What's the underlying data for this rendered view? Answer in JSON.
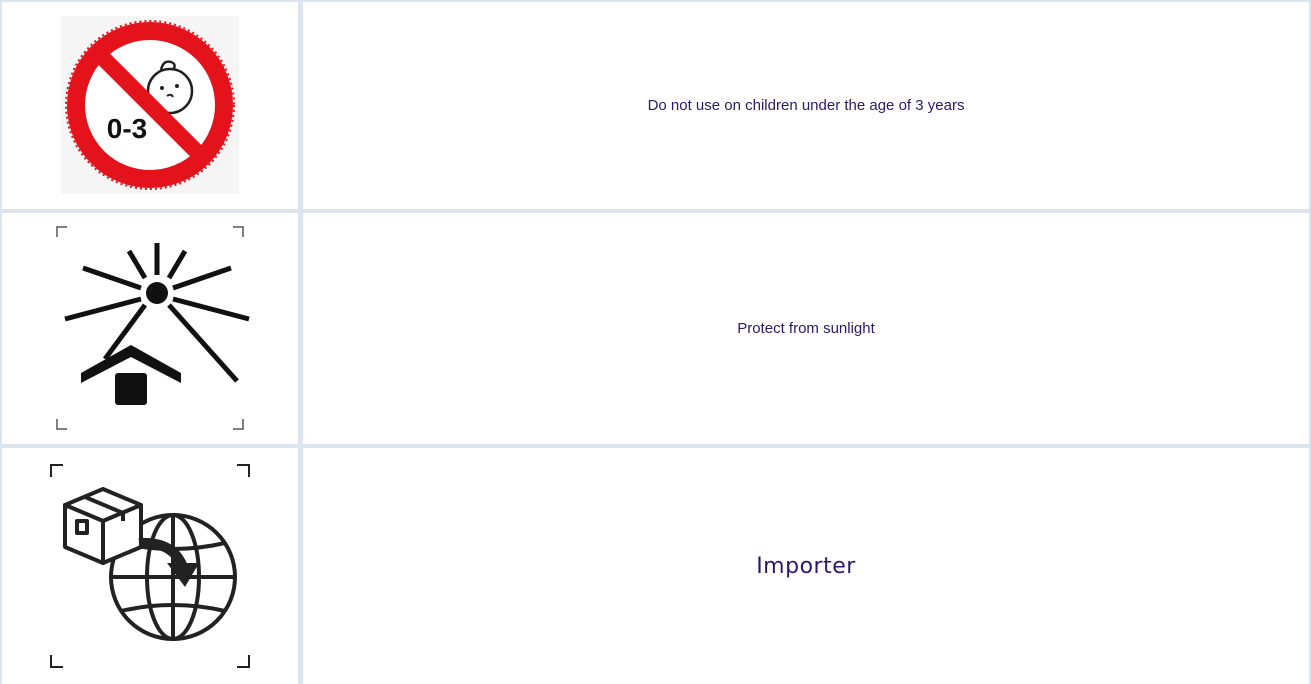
{
  "rows": [
    {
      "icon": "no-children-under-3-icon",
      "icon_text": "0-3",
      "label": "Do not use on children under the age of 3 years"
    },
    {
      "icon": "protect-from-sunlight-icon",
      "label": "Protect from sunlight"
    },
    {
      "icon": "importer-icon",
      "label": "Importer"
    }
  ],
  "colors": {
    "prohibition_red": "#e3121b",
    "text": "#2b1a67",
    "border": "#dbe4ef"
  }
}
